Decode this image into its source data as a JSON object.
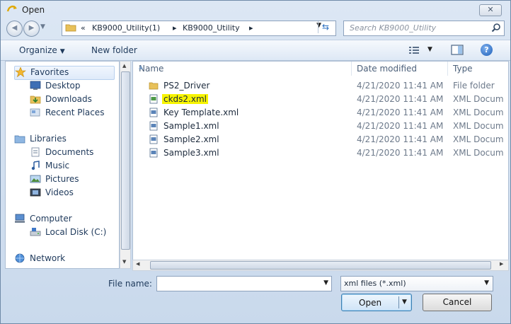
{
  "window": {
    "title": "Open",
    "close_glyph": "✕"
  },
  "nav": {
    "back_glyph": "◀",
    "forward_glyph": "▶",
    "recent_glyph": "▼",
    "breadcrumbs": [
      "«",
      "KB9000_Utility(1)",
      "▸",
      "KB9000_Utility",
      "▸"
    ],
    "refresh_glyph": "⇆",
    "search_placeholder": "Search KB9000_Utility"
  },
  "toolbar": {
    "organize": "Organize",
    "organize_caret": "▼",
    "new_folder": "New folder",
    "views_caret": "▼",
    "help_glyph": "?"
  },
  "sidebar": {
    "items": [
      {
        "label": "Favorites",
        "icon": "star-icon"
      },
      {
        "label": "Desktop",
        "icon": "desktop-icon"
      },
      {
        "label": "Downloads",
        "icon": "downloads-icon"
      },
      {
        "label": "Recent Places",
        "icon": "recent-places-icon"
      },
      {
        "label": "Libraries",
        "icon": "libraries-icon"
      },
      {
        "label": "Documents",
        "icon": "documents-icon"
      },
      {
        "label": "Music",
        "icon": "music-icon"
      },
      {
        "label": "Pictures",
        "icon": "pictures-icon"
      },
      {
        "label": "Videos",
        "icon": "videos-icon"
      },
      {
        "label": "Computer",
        "icon": "computer-icon"
      },
      {
        "label": "Local Disk (C:)",
        "icon": "local-disk-icon"
      },
      {
        "label": "Network",
        "icon": "network-icon"
      }
    ]
  },
  "file_list": {
    "columns": [
      "Name",
      "Date modified",
      "Type"
    ],
    "sort_indicator": "▲",
    "rows": [
      {
        "name": "PS2_Driver",
        "date": "4/21/2020 11:41 AM",
        "type": "File folder",
        "icon": "folder-icon"
      },
      {
        "name": "ckds2.xml",
        "date": "4/21/2020 11:41 AM",
        "type": "XML Docum",
        "icon": "xml-file-icon",
        "highlighted": true
      },
      {
        "name": "Key Template.xml",
        "date": "4/21/2020 11:41 AM",
        "type": "XML Docum",
        "icon": "xml-file-icon"
      },
      {
        "name": "Sample1.xml",
        "date": "4/21/2020 11:41 AM",
        "type": "XML Docum",
        "icon": "xml-file-icon"
      },
      {
        "name": "Sample2.xml",
        "date": "4/21/2020 11:41 AM",
        "type": "XML Docum",
        "icon": "xml-file-icon"
      },
      {
        "name": "Sample3.xml",
        "date": "4/21/2020 11:41 AM",
        "type": "XML Docum",
        "icon": "xml-file-icon"
      }
    ]
  },
  "scroll": {
    "up": "▲",
    "down": "▼",
    "left": "◀",
    "right": "▶"
  },
  "footer": {
    "file_name_label": "File name:",
    "file_name_value": "",
    "file_name_caret": "▼",
    "file_type_value": "xml files (*.xml)",
    "file_type_caret": "▼",
    "open_label": "Open",
    "open_caret": "▼",
    "cancel_label": "Cancel"
  },
  "colors": {
    "highlight": "#f7f400",
    "accent": "#1d5fb8",
    "window_bg": "#dce7f4"
  }
}
